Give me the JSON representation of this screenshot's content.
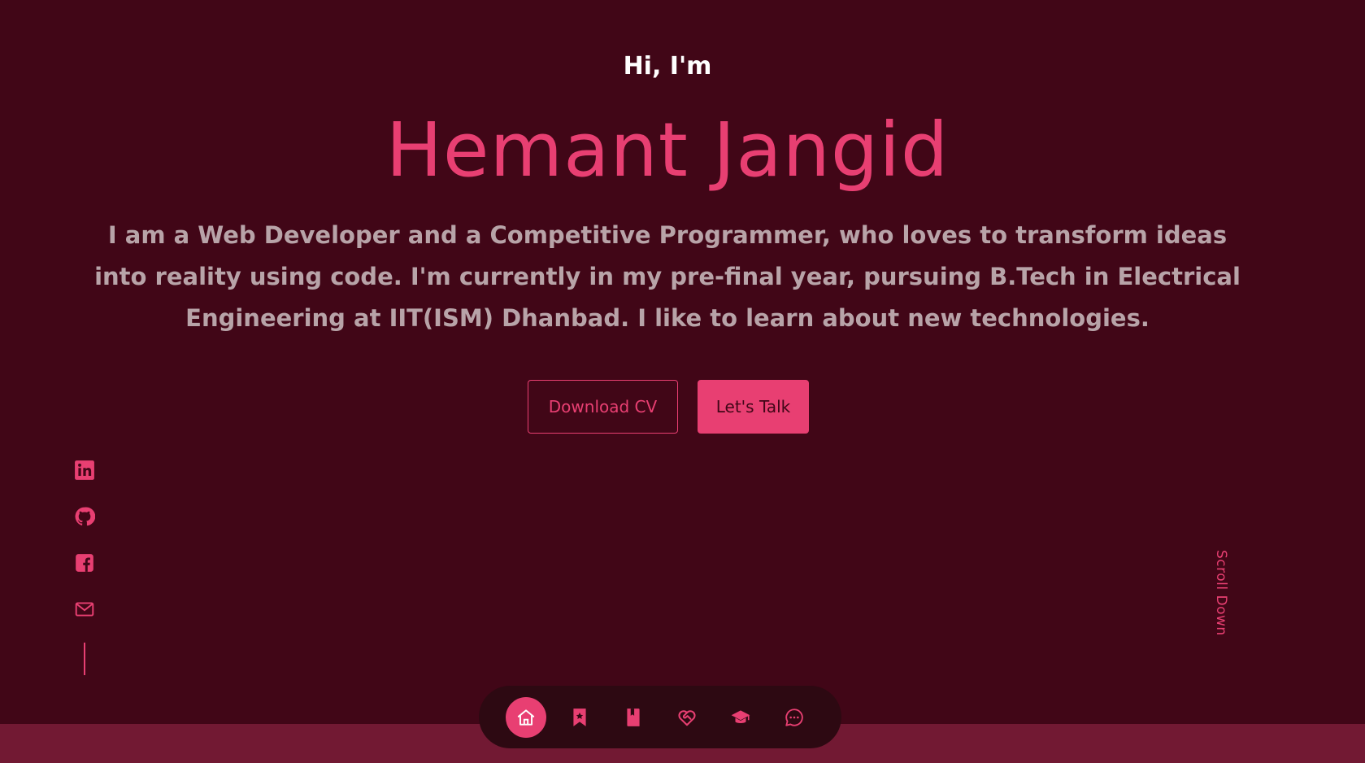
{
  "hero": {
    "greeting": "Hi, I'm",
    "name": "Hemant Jangid",
    "bio": "I am a Web Developer and a Competitive Programmer, who loves to transform ideas into reality using code. I'm currently in my pre-final year, pursuing B.Tech in Electrical Engineering at IIT(ISM) Dhanbad. I like to learn about new technologies."
  },
  "buttons": {
    "download_cv": "Download CV",
    "lets_talk": "Let's Talk"
  },
  "socials": [
    {
      "icon": "linkedin-icon"
    },
    {
      "icon": "github-icon"
    },
    {
      "icon": "facebook-icon"
    },
    {
      "icon": "mail-icon"
    }
  ],
  "scroll_down": "Scroll Down",
  "nav": {
    "items": [
      {
        "icon": "home-icon",
        "active": true
      },
      {
        "icon": "bookmark-star-icon",
        "active": false
      },
      {
        "icon": "book-icon",
        "active": false
      },
      {
        "icon": "heart-handshake-icon",
        "active": false
      },
      {
        "icon": "graduation-cap-icon",
        "active": false
      },
      {
        "icon": "chat-icon",
        "active": false
      }
    ]
  },
  "colors": {
    "background": "#410617",
    "accent": "#e83f72",
    "bio_text": "#b8a3a8",
    "nav_bg": "#2d0912",
    "bottom_band": "#721933"
  }
}
